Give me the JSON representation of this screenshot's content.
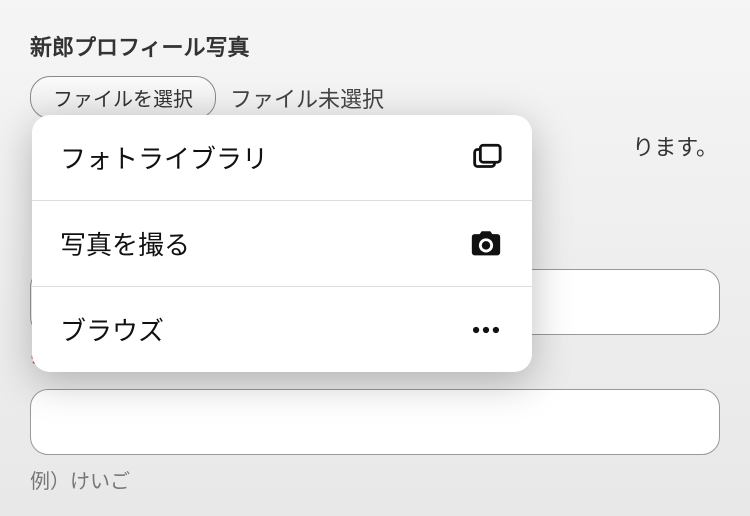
{
  "section": {
    "photo_label": "新郎プロフィール写真",
    "file_button": "ファイルを選択",
    "file_status": "ファイル未選択",
    "hint_trailing": "ります。"
  },
  "popup": {
    "items": [
      {
        "label": "フォトライブラリ",
        "icon": "photo-library-icon"
      },
      {
        "label": "写真を撮る",
        "icon": "camera-icon"
      },
      {
        "label": "ブラウズ",
        "icon": "more-icon"
      }
    ]
  },
  "form": {
    "required_mark": "※",
    "example_label": "例）けいご"
  }
}
